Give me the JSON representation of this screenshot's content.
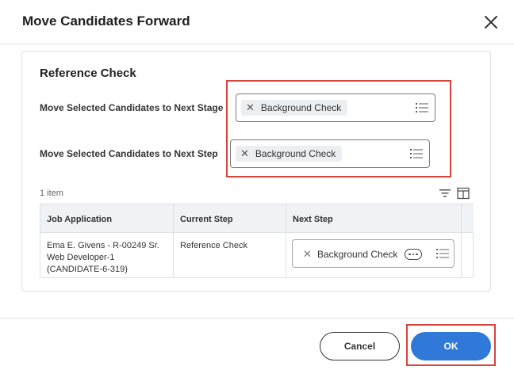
{
  "dialog": {
    "title": "Move Candidates Forward"
  },
  "section": {
    "title": "Reference Check",
    "stage_label": "Move Selected Candidates to Next Stage",
    "stage_value": "Background Check",
    "step_label": "Move Selected Candidates to Next Step",
    "step_value": "Background Check"
  },
  "table": {
    "count": "1 item",
    "headers": [
      "Job Application",
      "Current Step",
      "Next Step"
    ],
    "rows": [
      {
        "job_application": "Ema E. Givens - R-00249 Sr. Web Developer-1 (CANDIDATE-6-319)",
        "current_step": "Reference Check",
        "next_step": "Background Check"
      }
    ]
  },
  "footer": {
    "cancel_label": "Cancel",
    "ok_label": "OK"
  },
  "colors": {
    "primary": "#3179d8",
    "highlight": "#d9413b"
  },
  "icons": {
    "close": "close-icon",
    "remove": "remove-x-icon",
    "prompt": "list-icon",
    "filter": "filter-icon",
    "columns": "columns-icon",
    "related_actions": "related-actions-icon"
  }
}
